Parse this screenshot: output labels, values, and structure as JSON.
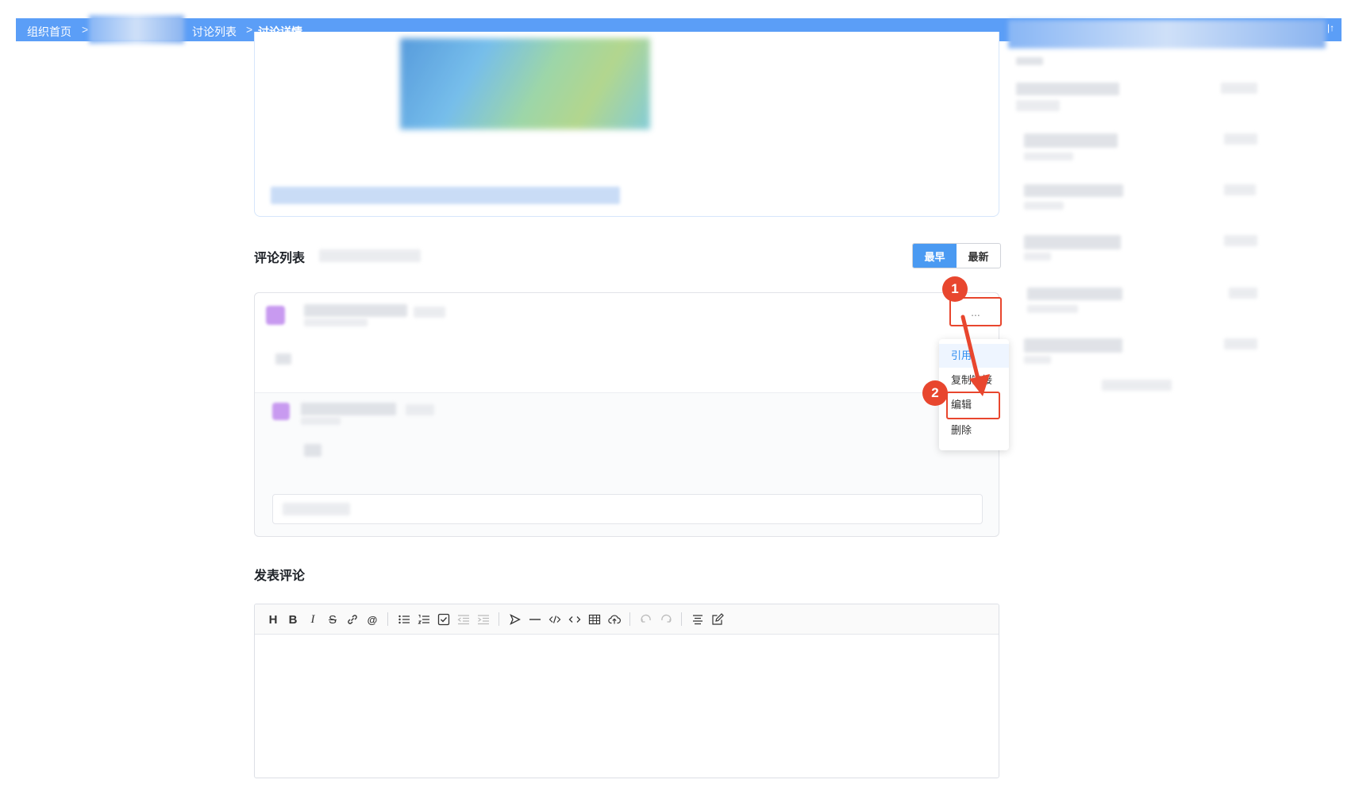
{
  "breadcrumb": {
    "home": "组织首页",
    "list": "讨论列表",
    "detail": "讨论详情",
    "separator": ">"
  },
  "comments": {
    "title": "评论列表",
    "sort_earliest": "最早",
    "sort_latest": "最新",
    "more_label": "..."
  },
  "menu": {
    "items": [
      "引用",
      "复制链接",
      "编辑",
      "删除"
    ]
  },
  "steps": {
    "step1": "1",
    "step2": "2"
  },
  "post_comment": {
    "title": "发表评论"
  },
  "editor": {
    "toolbar": [
      "heading-icon",
      "bold-icon",
      "italic-icon",
      "strikethrough-icon",
      "link-icon",
      "mention-icon",
      "bullet-list-icon",
      "ordered-list-icon",
      "task-list-icon",
      "outdent-icon",
      "indent-icon",
      "quote-icon",
      "hr-icon",
      "code-icon",
      "code-block-icon",
      "table-icon",
      "upload-icon",
      "undo-icon",
      "redo-icon",
      "align-center-icon",
      "preview-icon"
    ]
  },
  "colors": {
    "topbar": "#5b9ef7",
    "accent": "#4a9af2",
    "annotation": "#e8462e"
  }
}
